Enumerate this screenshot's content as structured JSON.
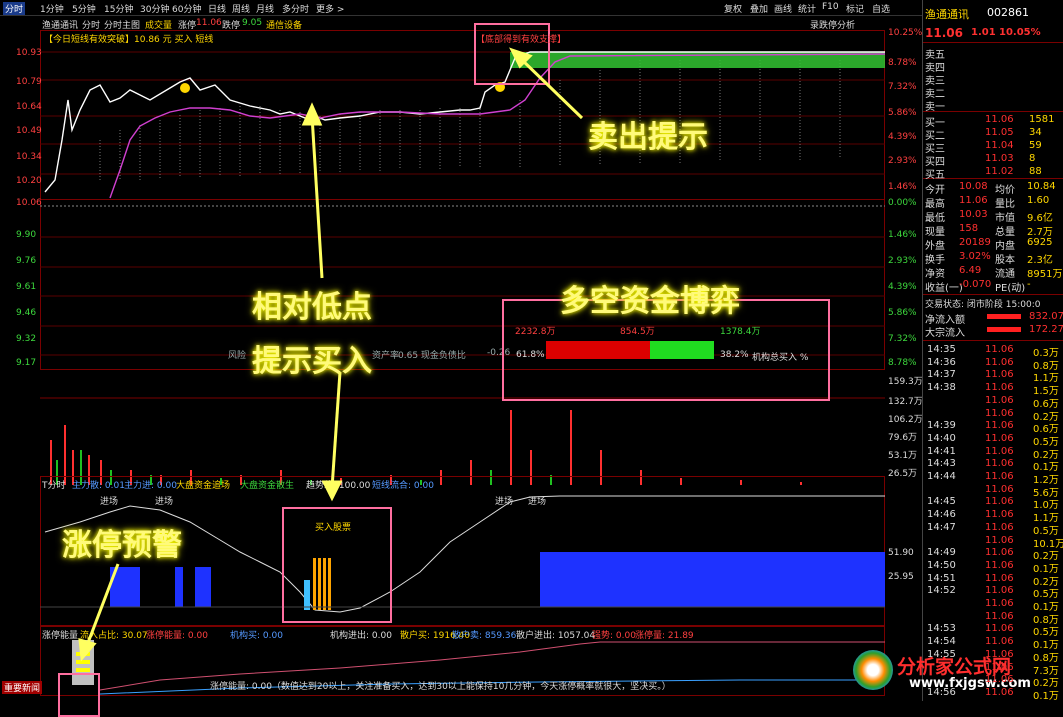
{
  "topbar": {
    "tabs": [
      "分时",
      "1分钟",
      "5分钟",
      "15分钟",
      "30分钟",
      "60分钟",
      "日线",
      "周线",
      "月线",
      "多分时",
      "更多 >"
    ],
    "active": 0
  },
  "toolbar": [
    "复权",
    "叠加",
    "画线",
    "统计",
    "F10",
    "标记",
    "自选"
  ],
  "header": {
    "name": "渔通通讯",
    "period": "分时",
    "mode": "分时主图",
    "ind1": "成交量",
    "limit_up_label": "涨停",
    "limit_up": "11.06",
    "limit_down_label": "跌停",
    "limit_down": "9.05",
    "sector": "通信设备",
    "compare": "录跌停分析",
    "breakout_note": "【今日短线有效突破】10.86 元 买入 短线"
  },
  "price_axis_left": [
    "10.93",
    "10.79",
    "10.64",
    "10.49",
    "10.34",
    "10.20",
    "10.06",
    "9.90",
    "9.76",
    "9.61",
    "9.46",
    "9.32",
    "9.17"
  ],
  "pct_axis_right": [
    "10.25%",
    "8.78%",
    "7.32%",
    "5.86%",
    "4.39%",
    "2.93%",
    "1.46%",
    "0.00%",
    "1.46%",
    "2.93%",
    "4.39%",
    "5.86%",
    "7.32%",
    "8.78%"
  ],
  "volume_axis": [
    "159.3万",
    "132.7万",
    "106.2万",
    "79.6万",
    "53.1万",
    "26.5万"
  ],
  "indicator_panel": {
    "title": "T分时",
    "labels": [
      "主力散: 0.01",
      "主力进: 0.00",
      "大盘资金追场",
      "大盘资金散生",
      "趋势线: 100.00",
      "短线流合: 0.00"
    ],
    "tags_top": [
      "进场",
      "进场",
      "进场",
      "进场"
    ],
    "buy_tag": "买入股票",
    "axis": [
      "51.90",
      "25.95"
    ]
  },
  "ratio_row": {
    "label": "风险",
    "items": [
      "资产率",
      "0.65 现金负债比",
      "-0.26"
    ]
  },
  "bottom_panel": {
    "title": "涨停能量",
    "labels": [
      "流入占比: 30.07",
      "涨停能量: 0.00",
      "机构买: 0.00",
      "机构出: 0.00",
      "机构进出: 0.00",
      "散户买: 1916.40",
      "散户卖: 859.36",
      "散户进出: 1057.04",
      "强势: 0.00",
      "涨停量: 21.89"
    ],
    "note": "涨停能量: 0.00（数值达到20以上，关注准备买入，达到30以上能保持10几分钟，今天涨停概率就很大，坚决买。）",
    "news": "重要新闻"
  },
  "fund_box": {
    "values": [
      "2232.8万",
      "854.5万",
      "1378.4万"
    ],
    "left_pct": "61.8%",
    "right_pct": "38.2%",
    "caption": "机构总买入 %",
    "ratio": 0.618
  },
  "callouts": {
    "sell": "卖出提示",
    "low1": "相对低点",
    "low2": "提示买入",
    "fund": "多空资金博弈",
    "limit": "涨停预警",
    "top_box": "【底部得到有效支撑】"
  },
  "side": {
    "name": "渔通通讯",
    "code": "002861",
    "price": "11.06",
    "change": "1.01",
    "pct": "10.05%",
    "asks": [
      {
        "label": "卖五",
        "price": "",
        "vol": ""
      },
      {
        "label": "卖四",
        "price": "",
        "vol": ""
      },
      {
        "label": "卖三",
        "price": "",
        "vol": ""
      },
      {
        "label": "卖二",
        "price": "",
        "vol": ""
      },
      {
        "label": "卖一",
        "price": "",
        "vol": ""
      }
    ],
    "bids": [
      {
        "label": "买一",
        "price": "11.06",
        "vol": "1581"
      },
      {
        "label": "买二",
        "price": "11.05",
        "vol": "34"
      },
      {
        "label": "买三",
        "price": "11.04",
        "vol": "59"
      },
      {
        "label": "买四",
        "price": "11.03",
        "vol": "8"
      },
      {
        "label": "买五",
        "price": "11.02",
        "vol": "88"
      }
    ],
    "stats": [
      {
        "k": "今开",
        "v": "10.08",
        "k2": "均价",
        "v2": "10.84"
      },
      {
        "k": "最高",
        "v": "11.06",
        "k2": "量比",
        "v2": "1.60"
      },
      {
        "k": "最低",
        "v": "10.03",
        "k2": "市值",
        "v2": "9.6亿"
      },
      {
        "k": "现量",
        "v": "158",
        "k2": "总量",
        "v2": "2.7万"
      },
      {
        "k": "外盘",
        "v": "20189",
        "k2": "内盘",
        "v2": "6925"
      },
      {
        "k": "换手",
        "v": "3.02%",
        "k2": "股本",
        "v2": "2.3亿"
      },
      {
        "k": "净资",
        "v": "6.49",
        "k2": "流通",
        "v2": "8951万"
      },
      {
        "k": "收益(一)",
        "v": "-0.070",
        "k2": "PE(动)",
        "v2": "-"
      }
    ],
    "trade_status": "交易状态: 闭市阶段 15:00:0",
    "inflow": [
      {
        "k": "净流入额",
        "v": "832.07"
      },
      {
        "k": "大宗流入",
        "v": "172.27"
      }
    ],
    "ticks": [
      {
        "t": "14:35",
        "p": "11.06",
        "v": "0.3万"
      },
      {
        "t": "14:36",
        "p": "11.06",
        "v": "0.8万"
      },
      {
        "t": "14:37",
        "p": "11.06",
        "v": "1.1万"
      },
      {
        "t": "14:38",
        "p": "11.06",
        "v": "1.5万"
      },
      {
        "t": "",
        "p": "11.06",
        "v": "0.6万"
      },
      {
        "t": "",
        "p": "11.06",
        "v": "0.2万"
      },
      {
        "t": "14:39",
        "p": "11.06",
        "v": "0.6万"
      },
      {
        "t": "14:40",
        "p": "11.06",
        "v": "0.5万"
      },
      {
        "t": "14:41",
        "p": "11.06",
        "v": "0.2万"
      },
      {
        "t": "14:43",
        "p": "11.06",
        "v": "0.1万"
      },
      {
        "t": "14:44",
        "p": "11.06",
        "v": "1.2万"
      },
      {
        "t": "",
        "p": "11.06",
        "v": "5.6万"
      },
      {
        "t": "14:45",
        "p": "11.06",
        "v": "1.0万"
      },
      {
        "t": "14:46",
        "p": "11.06",
        "v": "1.1万"
      },
      {
        "t": "14:47",
        "p": "11.06",
        "v": "0.5万"
      },
      {
        "t": "",
        "p": "11.06",
        "v": "10.1万"
      },
      {
        "t": "14:49",
        "p": "11.06",
        "v": "0.2万"
      },
      {
        "t": "14:50",
        "p": "11.06",
        "v": "0.1万"
      },
      {
        "t": "14:51",
        "p": "11.06",
        "v": "0.2万"
      },
      {
        "t": "14:52",
        "p": "11.06",
        "v": "0.5万"
      },
      {
        "t": "",
        "p": "11.06",
        "v": "0.1万"
      },
      {
        "t": "",
        "p": "11.06",
        "v": "0.8万"
      },
      {
        "t": "14:53",
        "p": "11.06",
        "v": "0.5万"
      },
      {
        "t": "14:54",
        "p": "11.06",
        "v": "0.1万"
      },
      {
        "t": "14:55",
        "p": "11.06",
        "v": "0.8万"
      },
      {
        "t": "",
        "p": "11.06",
        "v": "7.3万"
      },
      {
        "t": "",
        "p": "11.06",
        "v": "0.2万"
      },
      {
        "t": "14:56",
        "p": "11.06",
        "v": "0.1万"
      }
    ],
    "logo": "分析家公式网",
    "site": "www.fxjgsw.com"
  }
}
